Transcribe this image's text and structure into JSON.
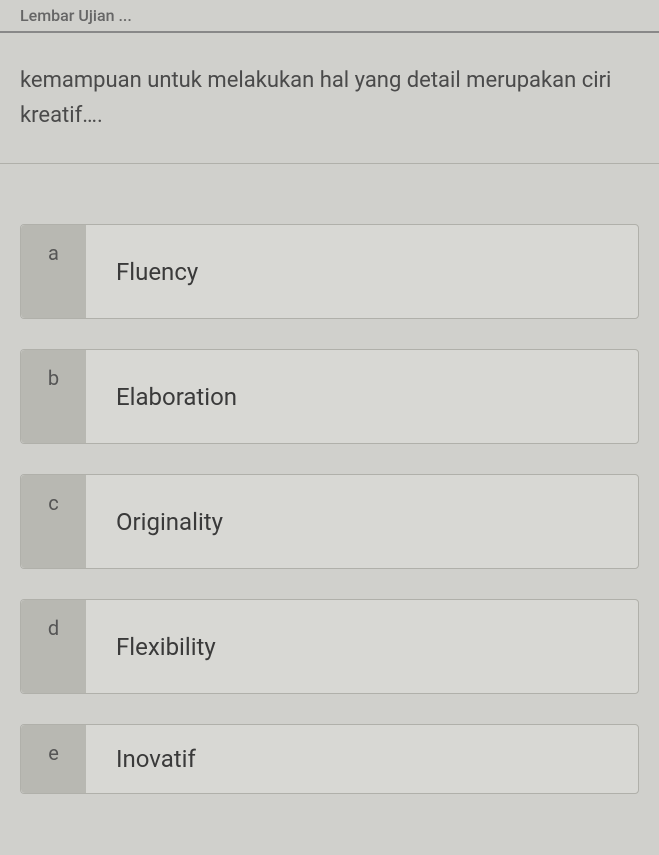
{
  "header": {
    "title": "Lembar Ujian ..."
  },
  "question": {
    "text": "kemampuan untuk melakukan hal yang detail merupakan ciri kreatif…."
  },
  "options": [
    {
      "letter": "a",
      "text": "Fluency"
    },
    {
      "letter": "b",
      "text": "Elaboration"
    },
    {
      "letter": "c",
      "text": "Originality"
    },
    {
      "letter": "d",
      "text": "Flexibility"
    },
    {
      "letter": "e",
      "text": "Inovatif"
    }
  ]
}
